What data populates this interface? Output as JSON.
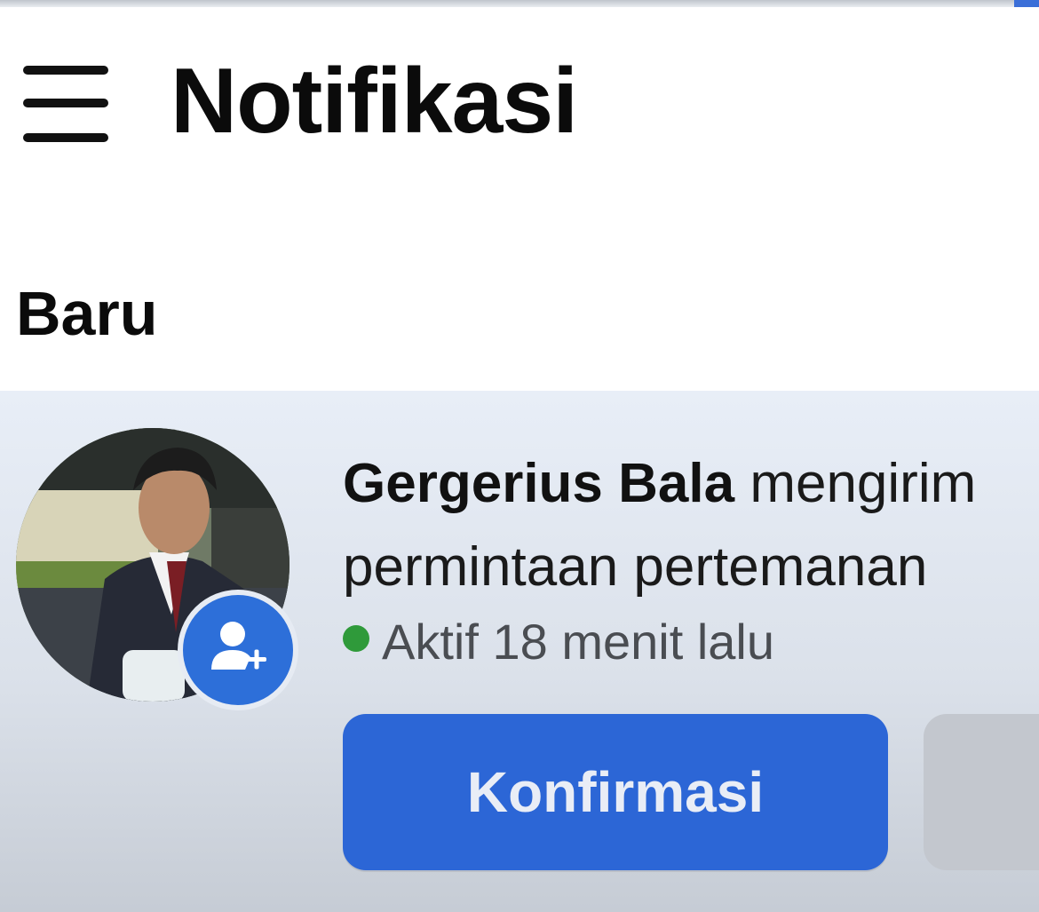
{
  "header": {
    "title": "Notifikasi",
    "menu_icon": "hamburger-menu-icon"
  },
  "section": {
    "label": "Baru"
  },
  "notification": {
    "sender_name": "Gergerius Bala",
    "message_line1_rest": " mengirim",
    "message_line2": "permintaan pertemanan",
    "status_text": "Aktif 18 menit lalu",
    "status_color": "#2f9a3a",
    "badge_icon": "add-friend-icon",
    "confirm_label": "Konfirmasi",
    "delete_label": ""
  },
  "colors": {
    "accent": "#2c66d6",
    "row_background": "#e8eef7",
    "secondary_button": "#c3c7ce"
  }
}
